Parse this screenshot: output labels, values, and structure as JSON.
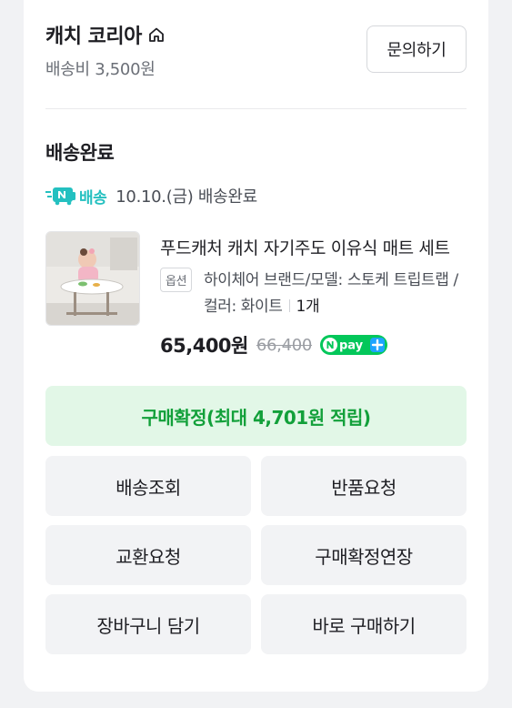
{
  "seller": {
    "name": "캐치 코리아",
    "shipping_fee": "배송비 3,500원",
    "inquiry_label": "문의하기"
  },
  "order": {
    "status_title": "배송완료",
    "delivery_badge": "배송",
    "delivery_info": "10.10.(금) 배송완료"
  },
  "product": {
    "name": "푸드캐처 캐치 자기주도 이유식 매트 세트",
    "option_tag": "옵션",
    "option_text": "하이체어 브랜드/모델: 스토케 트립트랩 / 컬러: 화이트",
    "quantity": "1개",
    "price": "65,400원",
    "original_price": "66,400",
    "pay_badge": "pay"
  },
  "actions": {
    "confirm": "구매확정(최대 4,701원 적립)",
    "track": "배송조회",
    "return": "반품요청",
    "exchange": "교환요청",
    "extend": "구매확정연장",
    "cart": "장바구니 담기",
    "buy_now": "바로 구매하기"
  },
  "colors": {
    "naver_green": "#03c75a",
    "naver_teal": "#24c0c0",
    "confirm_bg": "#e2f7e7",
    "confirm_text": "#12a03a"
  }
}
